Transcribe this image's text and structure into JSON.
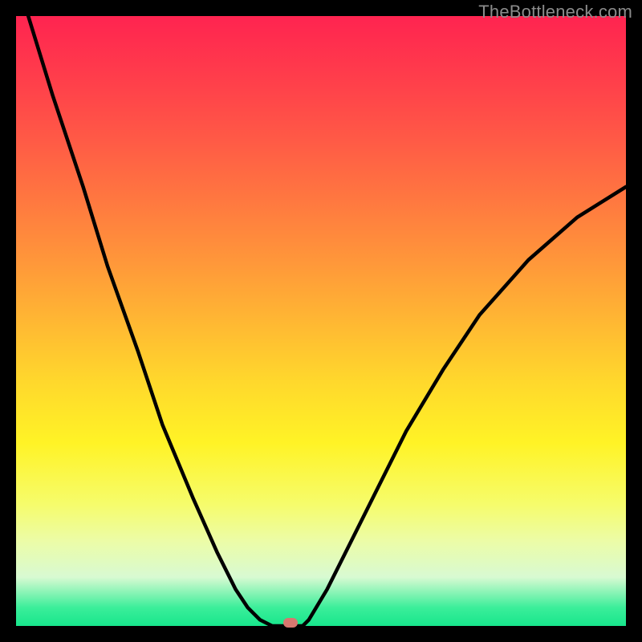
{
  "watermark": "TheBottleneck.com",
  "colors": {
    "frame": "#000000",
    "curve": "#000000",
    "dot": "#d7776f",
    "watermark": "#8b8b8b",
    "gradient_stops": [
      "#ff2450",
      "#ff3d4b",
      "#ff5946",
      "#ff7740",
      "#ff963a",
      "#ffb733",
      "#ffd82c",
      "#fff326",
      "#f6fc6b",
      "#ecfca6",
      "#d8fad2",
      "#3bee9a",
      "#17e68c"
    ]
  },
  "chart_data": {
    "type": "line",
    "title": "",
    "xlabel": "",
    "ylabel": "",
    "xlim": [
      0,
      100
    ],
    "ylim": [
      0,
      100
    ],
    "grid": false,
    "legend_position": "none",
    "series": [
      {
        "name": "curve",
        "x": [
          2,
          6,
          11,
          15,
          20,
          24,
          29,
          33,
          36,
          38,
          40,
          42,
          43,
          47,
          48,
          51,
          55,
          59,
          64,
          70,
          76,
          84,
          92,
          100
        ],
        "y": [
          100,
          87,
          72,
          59,
          45,
          33,
          21,
          12,
          6,
          3,
          1,
          0,
          0,
          0,
          1,
          6,
          14,
          22,
          32,
          42,
          51,
          60,
          67,
          72
        ]
      }
    ],
    "annotations": [
      {
        "name": "optimal-dot",
        "x": 45,
        "y": 0.5
      }
    ],
    "background": {
      "type": "vertical-gradient",
      "stops": [
        {
          "pos": 0.0,
          "color": "#ff2450"
        },
        {
          "pos": 0.5,
          "color": "#ffb733"
        },
        {
          "pos": 0.7,
          "color": "#fff326"
        },
        {
          "pos": 0.86,
          "color": "#ecfca6"
        },
        {
          "pos": 1.0,
          "color": "#17e68c"
        }
      ]
    }
  }
}
